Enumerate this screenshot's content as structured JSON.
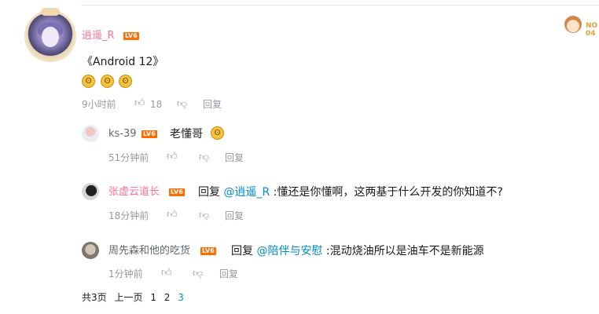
{
  "comment": {
    "user": "逍遥_R",
    "level": "LV6",
    "text": "《Android 12》",
    "emojis": [
      "喜极而泣",
      "喜极而泣",
      "喜极而泣"
    ],
    "time": "9小时前",
    "likes": "18",
    "reply_label": "回复"
  },
  "ad_badge": "NO 04",
  "replies": [
    {
      "user": "ks-39",
      "level": "LV6",
      "prefix": "",
      "mention": "",
      "text": "老懂哥",
      "time": "51分钟前",
      "reply_label": "回复"
    },
    {
      "user": "张虚云道长",
      "level": "LV6",
      "prefix": "回复 ",
      "mention": "@逍遥_R",
      "text": " :懂还是你懂啊，这两基于什么开发的你知道不?",
      "time": "18分钟前",
      "reply_label": "回复"
    },
    {
      "user": "周先森和他的吃货",
      "level": "LV6",
      "prefix": "回复 ",
      "mention": "@陪伴与安慰",
      "text": " :混动烧油所以是油车不是新能源",
      "time": "1分钟前",
      "reply_label": "回复"
    }
  ],
  "pager": {
    "total": "共3页",
    "prev": "上一页",
    "pages": [
      "1",
      "2",
      "3"
    ]
  },
  "colors": {
    "username_pink": "#fb7299",
    "mention_blue": "#008ac5",
    "level_orange": "#ff6c00",
    "meta_gray": "#9499a0"
  }
}
